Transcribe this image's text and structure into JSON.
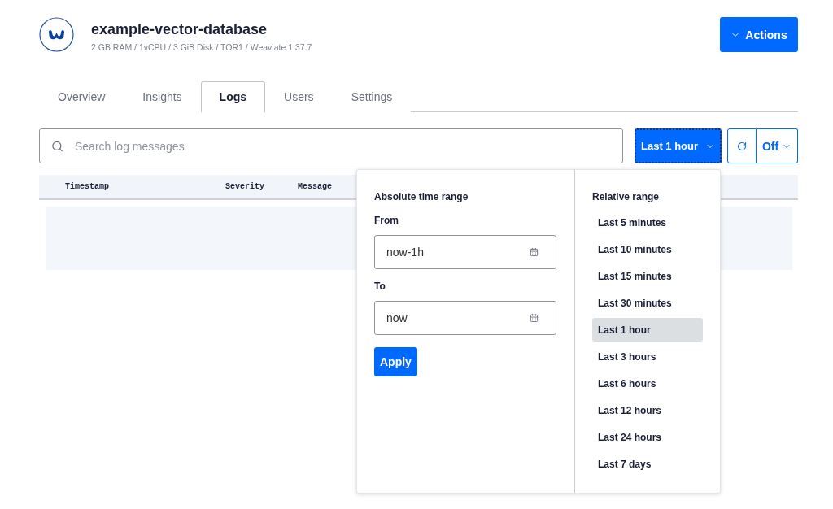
{
  "database": {
    "name": "example-vector-database",
    "specs": "2 GB RAM / 1vCPU / 3 GiB Disk / TOR1 / Weaviate 1.37.7"
  },
  "actions_button": {
    "label": "Actions"
  },
  "tabs": [
    {
      "label": "Overview",
      "selected": false
    },
    {
      "label": "Insights",
      "selected": false
    },
    {
      "label": "Logs",
      "selected": true
    },
    {
      "label": "Users",
      "selected": false
    },
    {
      "label": "Settings",
      "selected": false
    }
  ],
  "search": {
    "placeholder": "Search log messages"
  },
  "time_range_button": {
    "label": "Last 1 hour",
    "expanded": true
  },
  "refresh": {
    "interval": "Off"
  },
  "table": {
    "columns": [
      "Timestamp",
      "Severity",
      "Message"
    ]
  },
  "time_range_popover": {
    "absolute": {
      "title": "Absolute time range",
      "from_label": "From",
      "from_value": "now-1h",
      "to_label": "To",
      "to_value": "now",
      "apply_label": "Apply"
    },
    "relative": {
      "title": "Relative range",
      "options": [
        {
          "label": "Last 5 minutes",
          "selected": false
        },
        {
          "label": "Last 10 minutes",
          "selected": false
        },
        {
          "label": "Last 15 minutes",
          "selected": false
        },
        {
          "label": "Last 30 minutes",
          "selected": false
        },
        {
          "label": "Last 1 hour",
          "selected": true
        },
        {
          "label": "Last 3 hours",
          "selected": false
        },
        {
          "label": "Last 6 hours",
          "selected": false
        },
        {
          "label": "Last 12 hours",
          "selected": false
        },
        {
          "label": "Last 24 hours",
          "selected": false
        },
        {
          "label": "Last 7 days",
          "selected": false
        }
      ]
    }
  }
}
